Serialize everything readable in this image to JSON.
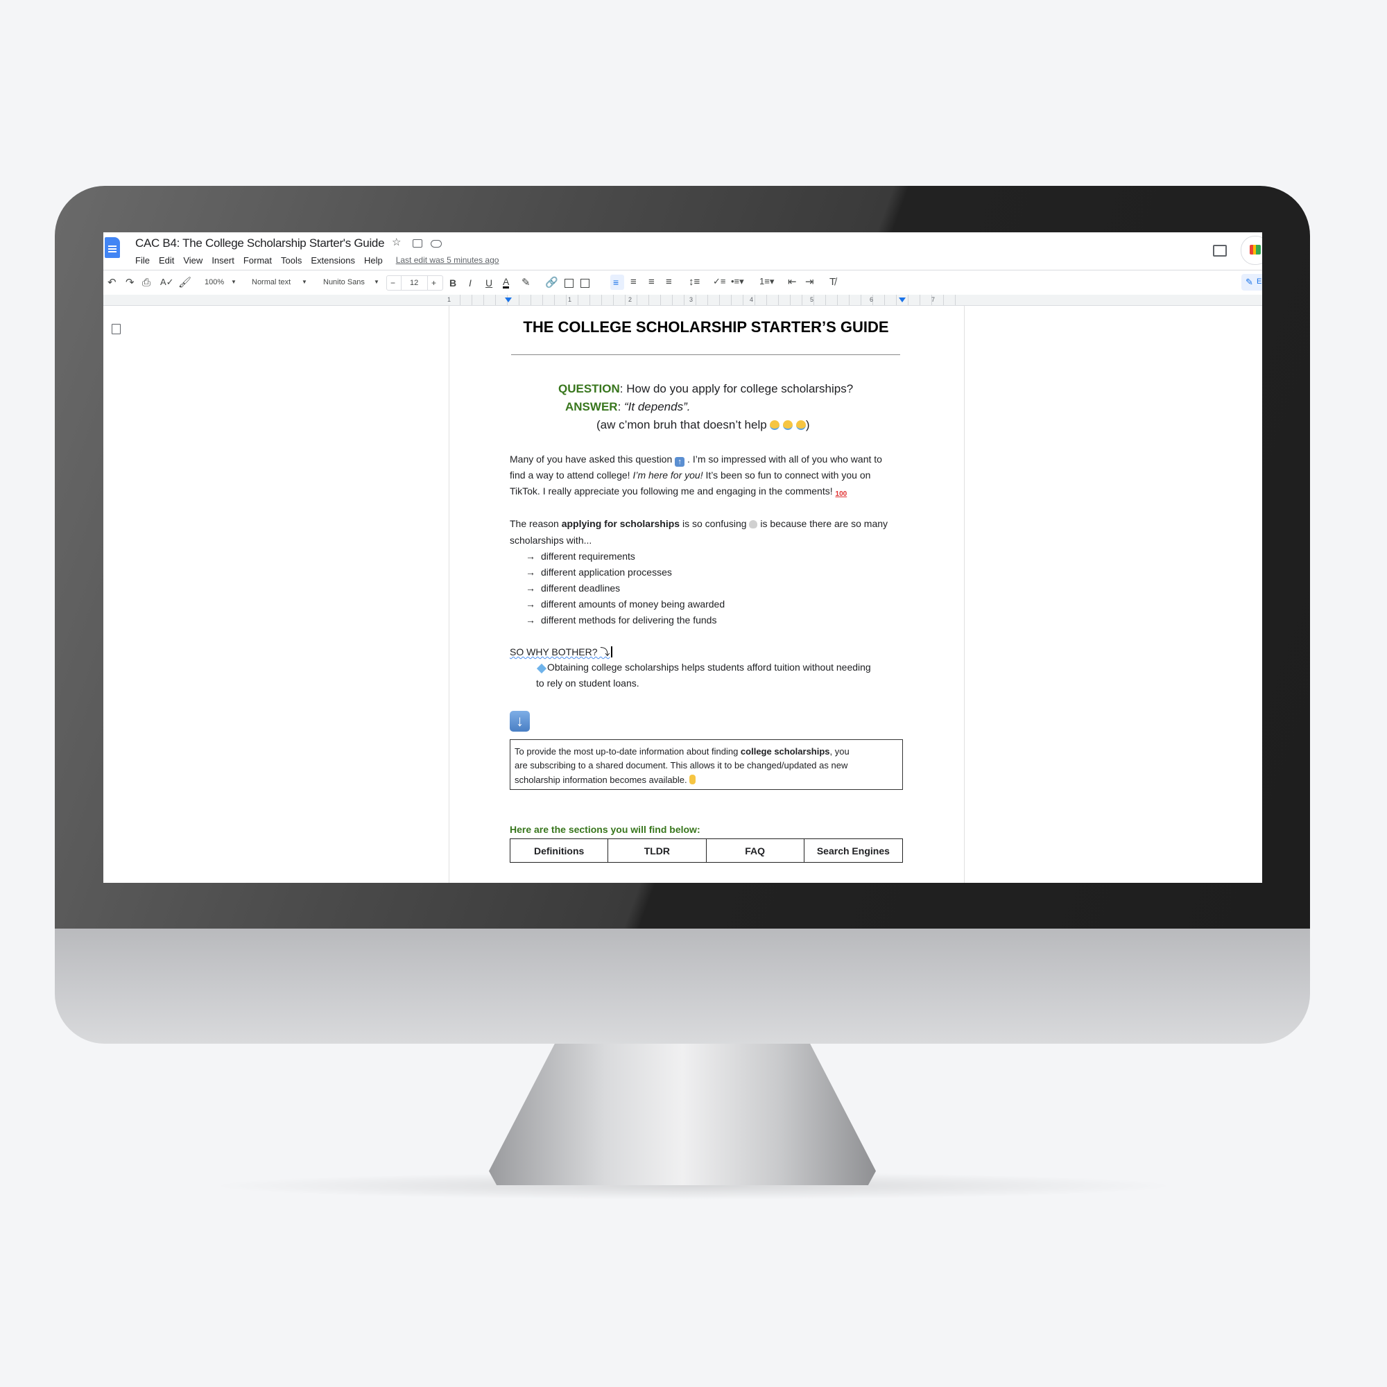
{
  "app": {
    "doc_title": "CAC B4: The College Scholarship Starter's Guide",
    "menu": [
      "File",
      "Edit",
      "View",
      "Insert",
      "Format",
      "Tools",
      "Extensions",
      "Help"
    ],
    "last_edit": "Last edit was 5 minutes ago",
    "edit_mode_label": "E"
  },
  "toolbar": {
    "zoom": "100%",
    "style": "Normal text",
    "font": "Nunito Sans",
    "font_size": "12",
    "bold": "B",
    "italic": "I",
    "underline": "U",
    "text_color": "A",
    "minus": "−",
    "plus": "+"
  },
  "ruler": {
    "labels": [
      "1",
      "1",
      "2",
      "3",
      "4",
      "5",
      "6",
      "7"
    ]
  },
  "document": {
    "heading": "THE COLLEGE SCHOLARSHIP STARTER’S GUIDE",
    "question_label": "QUESTION",
    "question_text": ": How do you apply for college scholarships?",
    "answer_label": "ANSWER",
    "answer_text_sep": ":  ",
    "answer_text": "“It depends”.",
    "aside_text": "(aw c’mon bruh that doesn’t help ",
    "aside_close": ")",
    "para1": {
      "line1_a": "Many of you have asked this question ",
      "line1_b": " . I’m so impressed with all of you who want to",
      "line2_a": "find a way to attend college! ",
      "line2_italic": "I’m here for you!",
      "line2_b": " It’s been so fun to connect with you on",
      "line3": "TikTok. I really appreciate you following me and engaging in the comments! "
    },
    "para2": {
      "line1_a": "The reason ",
      "line1_bold": "applying for scholarships",
      "line1_b": " is so confusing ",
      "line1_c": "  is because there are so many",
      "line2": "scholarships with..."
    },
    "bullets": [
      "different requirements",
      "different application processes",
      "different deadlines",
      "different amounts of money being awarded",
      "different methods for delivering the funds"
    ],
    "why_heading": "SO WHY BOTHER? ⤵",
    "why_line1": "Obtaining college scholarships helps students afford tuition without needing",
    "why_line2": "to rely on student loans.",
    "box": {
      "line1_a": "To provide the most up-to-date information about finding ",
      "line1_bold": "college scholarships",
      "line1_b": ", you",
      "line2": "are subscribing to a shared document. This allows it to be changed/updated as new",
      "line3": "scholarship information becomes available. "
    },
    "sections_heading": "Here are the sections you will find below:",
    "sections": [
      "Definitions",
      "TLDR",
      "FAQ",
      "Search Engines"
    ]
  },
  "icons": {
    "emoji_up": "up-arrow-emoji",
    "emoji_cry": "loudly-crying-face-emoji",
    "emoji_100": "hundred-points-emoji",
    "emoji_skull": "skull-emoji",
    "emoji_diamond": "diamond-emoji",
    "emoji_down": "down-arrow-emoji",
    "emoji_peace": "victory-hand-emoji",
    "bullet": "→"
  },
  "colors": {
    "accent_green": "#38761d",
    "docs_blue": "#4285f4",
    "bezel": "#222222"
  }
}
